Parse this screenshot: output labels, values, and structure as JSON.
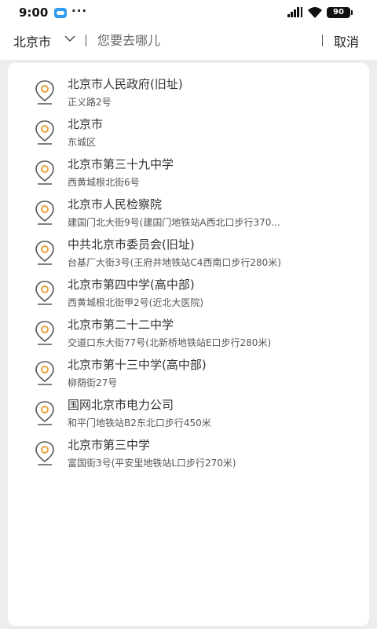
{
  "status_bar": {
    "time": "9:00",
    "extra": "···",
    "battery": "90"
  },
  "header": {
    "city": "北京市",
    "search_placeholder": "您要去哪儿",
    "cancel_label": "取消"
  },
  "results": [
    {
      "name": "北京市人民政府(旧址)",
      "address": "正义路2号"
    },
    {
      "name": "北京市",
      "address": "东城区"
    },
    {
      "name": "北京市第三十九中学",
      "address": "西黄城根北街6号"
    },
    {
      "name": "北京市人民检察院",
      "address": "建国门北大街9号(建国门地铁站A西北口步行370..."
    },
    {
      "name": "中共北京市委员会(旧址)",
      "address": "台基厂大街3号(王府井地铁站C4西南口步行280米)"
    },
    {
      "name": "北京市第四中学(高中部)",
      "address": "西黄城根北街甲2号(近北大医院)"
    },
    {
      "name": "北京市第二十二中学",
      "address": "交道口东大街77号(北新桥地铁站E口步行280米)"
    },
    {
      "name": "北京市第十三中学(高中部)",
      "address": "柳荫街27号"
    },
    {
      "name": "国网北京市电力公司",
      "address": "和平门地铁站B2东北口步行450米"
    },
    {
      "name": "北京市第三中学",
      "address": "富国街3号(平安里地铁站L口步行270米)"
    }
  ],
  "icons": {
    "location_pin": "location-pin-icon",
    "pin_accent": "#e8a33c",
    "pin_stroke": "#555555"
  }
}
